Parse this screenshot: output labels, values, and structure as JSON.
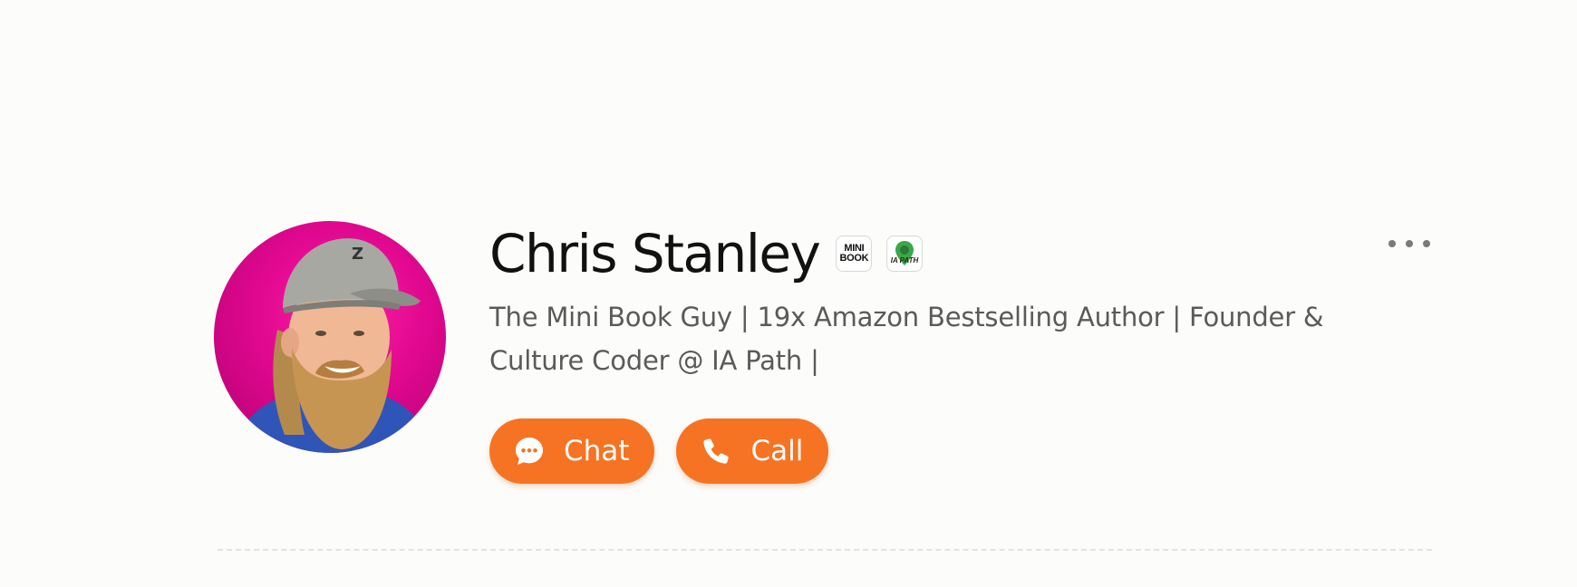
{
  "profile": {
    "name": "Chris Stanley",
    "bio": "The Mini Book Guy | 19x Amazon Bestselling Author | Founder & Culture Coder @ IA Path |",
    "badges": [
      {
        "label_line1": "MINI",
        "label_line2": "BOOK",
        "icon": "mini-book-logo"
      },
      {
        "label": "IA PATH",
        "icon": "ia-path-pin-logo"
      }
    ],
    "avatar_background": "#e0088f"
  },
  "actions": {
    "chat_label": "Chat",
    "chat_icon": "chat-bubble-icon",
    "call_label": "Call",
    "call_icon": "phone-icon",
    "accent_color": "#f57322"
  },
  "menu": {
    "icon": "more-options-icon"
  }
}
